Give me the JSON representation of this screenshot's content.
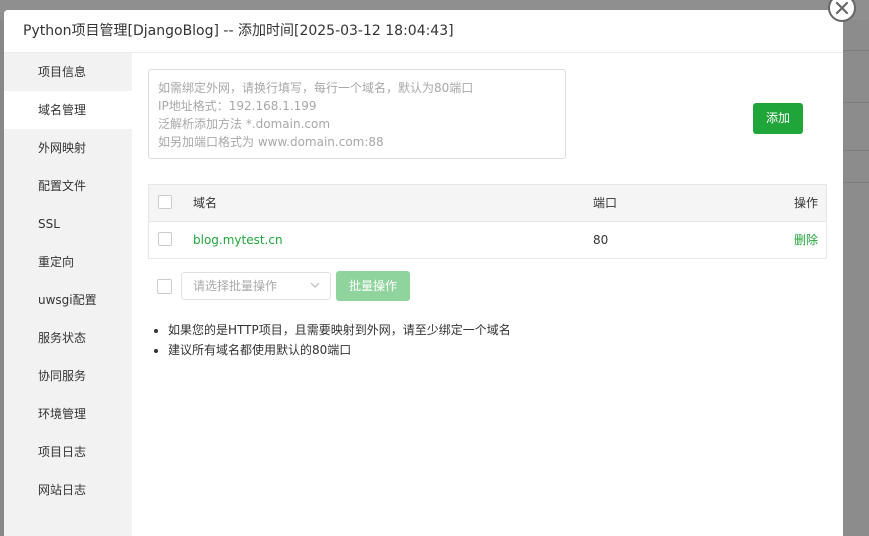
{
  "window": {
    "title": "Python项目管理[DjangoBlog] -- 添加时间[2025-03-12 18:04:43]"
  },
  "sidebar": {
    "items": [
      {
        "label": "项目信息"
      },
      {
        "label": "域名管理",
        "active": true
      },
      {
        "label": "外网映射"
      },
      {
        "label": "配置文件"
      },
      {
        "label": "SSL"
      },
      {
        "label": "重定向"
      },
      {
        "label": "uwsgi配置"
      },
      {
        "label": "服务状态"
      },
      {
        "label": "协同服务"
      },
      {
        "label": "环境管理"
      },
      {
        "label": "项目日志"
      },
      {
        "label": "网站日志"
      }
    ]
  },
  "domain_input": {
    "placeholder_lines": [
      "如需绑定外网，请换行填写，每行一个域名，默认为80端口",
      "IP地址格式：192.168.1.199",
      "泛解析添加方法 *.domain.com",
      "如另加端口格式为 www.domain.com:88"
    ]
  },
  "add_button": {
    "label": "添加"
  },
  "table": {
    "headers": {
      "domain": "域名",
      "port": "端口",
      "action": "操作"
    },
    "rows": [
      {
        "domain": "blog.mytest.cn",
        "port": "80",
        "action": "删除"
      }
    ]
  },
  "batch": {
    "select_placeholder": "请选择批量操作",
    "button_label": "批量操作"
  },
  "tips": [
    "如果您的是HTTP项目，且需要映射到外网，请至少绑定一个域名",
    "建议所有域名都使用默认的80端口"
  ],
  "colors": {
    "accent": "#20a53a",
    "accent_disabled": "#90d49d",
    "sidebar_bg": "#f2f2f2"
  }
}
